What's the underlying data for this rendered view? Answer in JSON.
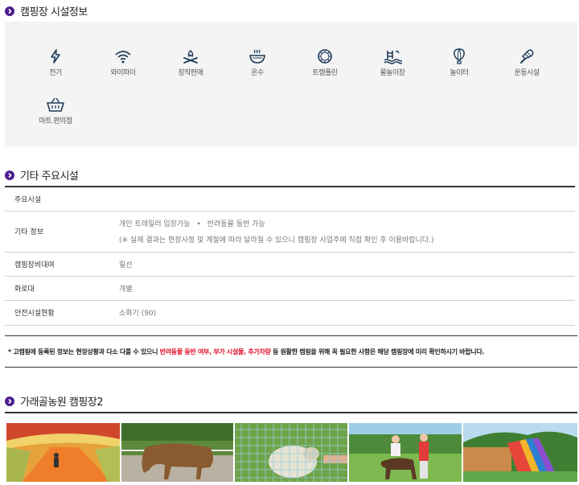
{
  "sections": {
    "facilities_title": "캠핑장 시설정보",
    "other_title": "기타 주요시설",
    "gallery_title": "가래골농원 캠핑장2"
  },
  "facilities": [
    {
      "label": "전기",
      "icon": "lightning-icon"
    },
    {
      "label": "와이파이",
      "icon": "wifi-icon"
    },
    {
      "label": "장작판매",
      "icon": "campfire-icon"
    },
    {
      "label": "온수",
      "icon": "hot-water-icon"
    },
    {
      "label": "트렘폴린",
      "icon": "trampoline-icon"
    },
    {
      "label": "물놀이장",
      "icon": "pool-icon"
    },
    {
      "label": "놀이터",
      "icon": "balloon-icon"
    },
    {
      "label": "운동시설",
      "icon": "badminton-icon"
    },
    {
      "label": "마트.편의점",
      "icon": "basket-icon"
    }
  ],
  "info_table": {
    "main_facilities_label": "주요시설",
    "main_facilities_value": "",
    "other_info_label": "기타 정보",
    "other_info_items": [
      "개인 트레일러 입장가능",
      "반려동물 동반 가능"
    ],
    "other_info_separator": "•",
    "other_info_note": "(※ 실제 결과는 현장사정 및 계절에 따라 달라질 수 있으니 캠핑장 사업주에 직접 확인 후 이용바랍니다.)",
    "rental_label": "캠핑장비대여",
    "rental_value": "릴선",
    "fire_label": "화로대",
    "fire_value": "개별",
    "safety_label": "안전시설현황",
    "safety_value": "소화기 (90)"
  },
  "notice": {
    "prefix": "* 고캠핑에 등록된 정보는 현장상황과 다소 다를 수 있으니 ",
    "highlight": "반려동물 동반 여부, 부가 시설물, 추가차량",
    "suffix": " 등 원활한 캠핑을 위해 꼭 필요한 사항은 해당 캠핑장에 미리 확인하시기 바랍니다."
  },
  "colors": {
    "accent": "#4b1f8e",
    "icon": "#1f3d5a",
    "highlight_red": "#e0102a",
    "facility_bg": "#f4f4f4"
  },
  "photos": [
    {
      "name": "tunnel-slide-photo"
    },
    {
      "name": "horse-photo"
    },
    {
      "name": "sheep-feeding-photo"
    },
    {
      "name": "pony-ride-photo"
    },
    {
      "name": "water-slide-photo"
    }
  ]
}
